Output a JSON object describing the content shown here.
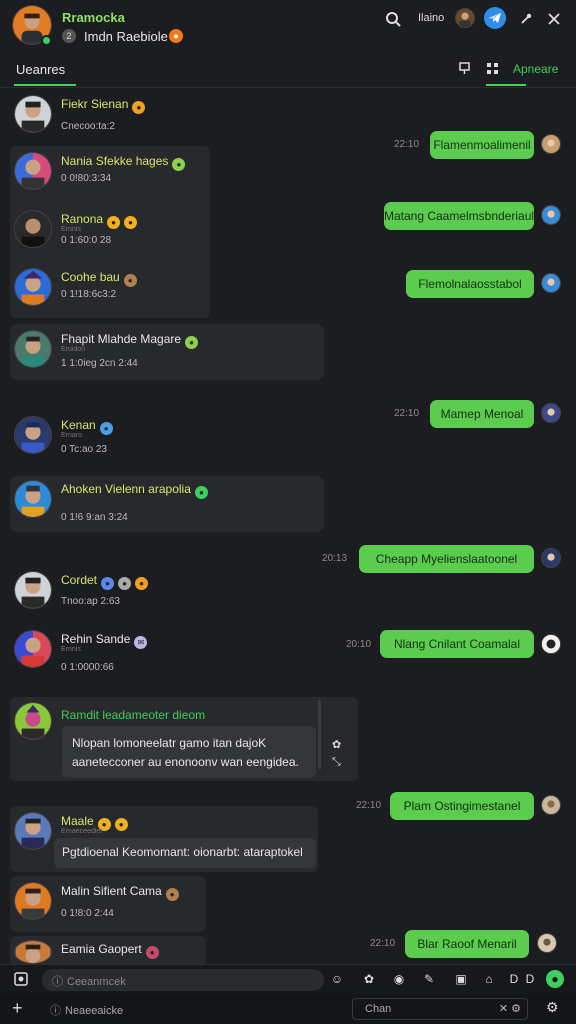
{
  "header": {
    "title": "Rramocka",
    "subtitle": "Imdn Raebiole",
    "status": "Ilaino",
    "badge_icon": "fire-emoji"
  },
  "tabs": {
    "main": "Ueanres",
    "right": "Apneare"
  },
  "colors": {
    "accent": "#3ecf5c",
    "bubble": "#5ccc4e",
    "bg": "#1c1d20",
    "card": "#28292d",
    "name": "#d6e86a"
  },
  "messages": [
    {
      "name": "Fiekr Sienan",
      "meta": "Cnecoo:ta:2"
    },
    {
      "name": "Nania Sfekke hages",
      "meta": "0 0!80:3:34"
    },
    {
      "name": "Ranona",
      "small": "Ernnis",
      "meta": "0 1:60:0 28"
    },
    {
      "name": "Coohe bau",
      "meta": "0 1!18:6c3:2"
    },
    {
      "name": "Fhapit Mlahde Magare",
      "small": "Eruidon",
      "meta": "1 1:0ieg 2cn 2:44"
    },
    {
      "name": "Kenan",
      "small": "Ernaro",
      "meta": "0 Tc:ao 23"
    },
    {
      "name": "Ahoken Vielenn arapolia",
      "meta": "0 1!6 9:an 3:24"
    },
    {
      "name": "Cordet",
      "meta": "Tnoo:ap 2:63"
    },
    {
      "name": "Rehin Sande",
      "small": "Ernnis",
      "meta": "0 1:0000:66"
    },
    {
      "name": "Ramdit leadameoter dieom",
      "text": "Nlopan lomoneelatr gamo itan dajoK aanetecconer au enonoonv wan eengidea."
    },
    {
      "name": "Maale",
      "small": "Ernaeceedier",
      "text": "Pgtdioenal Keomomant: oionarbt: ataraptokel"
    },
    {
      "name": "Malin Sifient Cama",
      "meta": "0 1!8:0 2:44"
    },
    {
      "name": "Eamia Gaopert",
      "meta": ""
    }
  ],
  "outgoing": [
    {
      "text": "Flamenmoalimenil",
      "time": "22:10"
    },
    {
      "text": "Matang Caamelmsbnderiaul",
      "time": ""
    },
    {
      "text": "Flemolnalaosstabol",
      "time": ""
    },
    {
      "text": "Mamep Menoal",
      "time": "22:10"
    },
    {
      "text": "Cheapp Myelienslaatoonel",
      "time": "20:13"
    },
    {
      "text": "Nlang Cnilant Coamalal",
      "time": "20:10"
    },
    {
      "text": "Plam Ostingimestanel",
      "time": "22:10"
    },
    {
      "text": "Blar Raoof Menaril",
      "time": "22:10"
    }
  ],
  "composer": {
    "placeholder": "Ceeanmcek"
  },
  "bottom": {
    "search_placeholder": "Neaeeaicke",
    "chat_label": "Chan"
  }
}
